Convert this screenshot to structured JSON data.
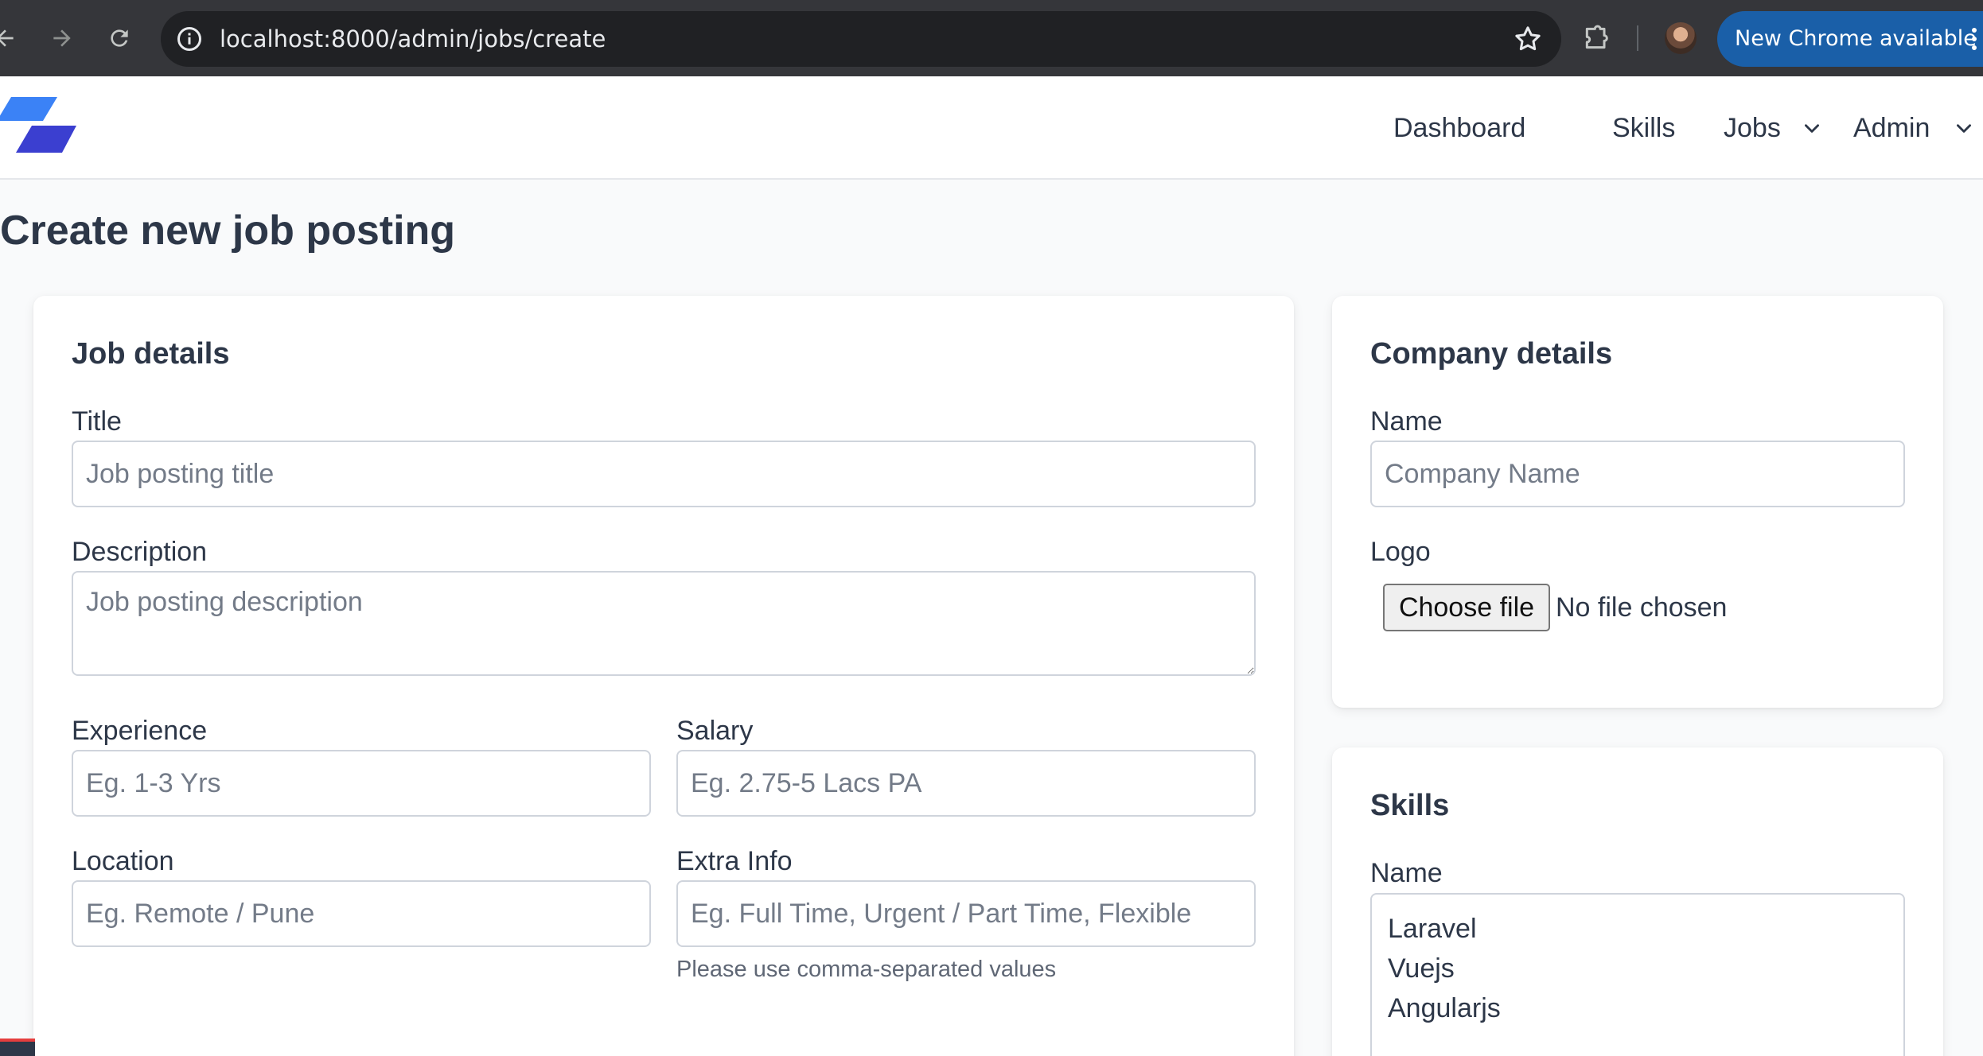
{
  "browser": {
    "url": "localhost:8000/admin/jobs/create",
    "update_label": "New Chrome available"
  },
  "nav": {
    "items": [
      {
        "label": "Dashboard",
        "has_dropdown": false
      },
      {
        "label": "Skills",
        "has_dropdown": false
      },
      {
        "label": "Jobs",
        "has_dropdown": true
      },
      {
        "label": "Admin",
        "has_dropdown": true
      }
    ]
  },
  "page": {
    "title": "Create new job posting"
  },
  "job_details": {
    "heading": "Job details",
    "title_label": "Title",
    "title_placeholder": "Job posting title",
    "description_label": "Description",
    "description_placeholder": "Job posting description",
    "experience_label": "Experience",
    "experience_placeholder": "Eg. 1-3 Yrs",
    "salary_label": "Salary",
    "salary_placeholder": "Eg. 2.75-5 Lacs PA",
    "location_label": "Location",
    "location_placeholder": "Eg. Remote / Pune",
    "extra_label": "Extra Info",
    "extra_placeholder": "Eg. Full Time, Urgent / Part Time, Flexible",
    "extra_help": "Please use comma-separated values"
  },
  "company_details": {
    "heading": "Company details",
    "name_label": "Name",
    "name_placeholder": "Company Name",
    "logo_label": "Logo",
    "file_button": "Choose file",
    "file_status": "No file chosen"
  },
  "skills": {
    "heading": "Skills",
    "name_label": "Name",
    "options": [
      "Laravel",
      "Vuejs",
      "Angularjs"
    ]
  },
  "colors": {
    "brand": "#2f55d4",
    "text": "#2d3748",
    "chrome_bg": "#35363a",
    "update_pill": "#1a5fa8"
  }
}
